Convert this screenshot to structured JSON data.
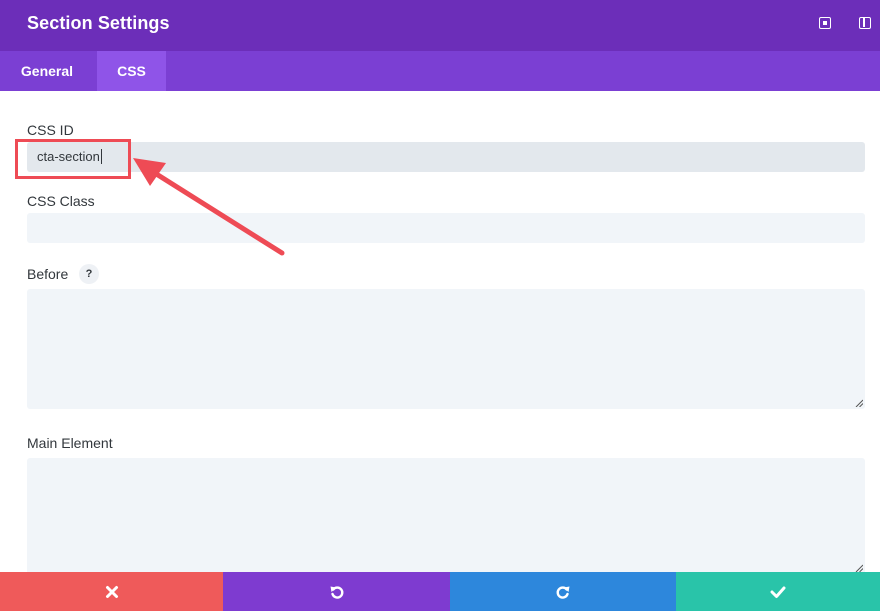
{
  "header": {
    "title": "Section Settings",
    "expand_icon": "expand-icon",
    "split_icon": "split-view-icon"
  },
  "tabs": [
    {
      "label": "General",
      "active": false
    },
    {
      "label": "CSS",
      "active": true
    }
  ],
  "fields": {
    "css_id": {
      "label": "CSS ID",
      "value": "cta-section"
    },
    "css_class": {
      "label": "CSS Class",
      "value": ""
    },
    "before": {
      "label": "Before",
      "help": "?",
      "value": ""
    },
    "main_element": {
      "label": "Main Element",
      "value": ""
    }
  },
  "footer": {
    "cancel_icon": "close-icon",
    "undo_icon": "undo-icon",
    "redo_icon": "redo-icon",
    "save_icon": "checkmark-icon"
  },
  "colors": {
    "header": "#6c2eb9",
    "tabs": "#7b3fd3",
    "active_tab": "#8f54e8",
    "cancel": "#ef5a5a",
    "undo": "#7e3bd0",
    "redo": "#2d87dc",
    "save": "#29c4a9",
    "annotation": "#ee4b55"
  }
}
